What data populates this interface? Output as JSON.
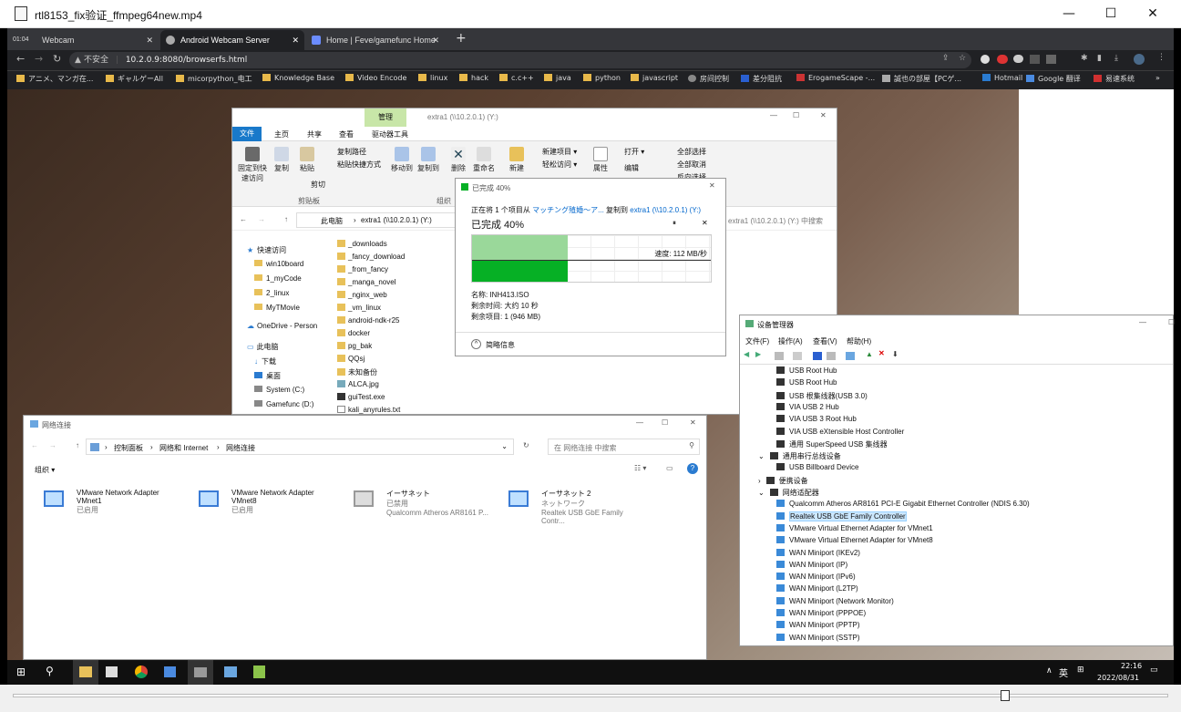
{
  "player": {
    "title": "rtl8153_fix验证_ffmpeg64new.mp4",
    "min": "—",
    "max": "☐",
    "close": "✕"
  },
  "browser": {
    "tabs": [
      {
        "label": "Webcam",
        "prefix": "01:04"
      },
      {
        "label": "Android Webcam Server"
      },
      {
        "label": "Home | Feve/gamefunc Home"
      }
    ],
    "new_tab": "+",
    "url_warning": "不安全",
    "url": "10.2.0.9:8080/browserfs.html",
    "bookmarks": [
      "アニメ、マンガ在...",
      "ギャルゲーAll",
      "micorpython_电工",
      "Knowledge Base",
      "Video Encode",
      "linux",
      "hack",
      "c.c++",
      "java",
      "python",
      "javascript",
      "房间控制",
      "差分阻抗",
      "ErogameScape -...",
      "誠也の部屋【PCゲ...",
      "Hotmail",
      "Google 翻译",
      "易速系统"
    ]
  },
  "explorer": {
    "title": "extra1 (\\\\10.2.0.1) (Y:)",
    "manage_tab": "管理",
    "tabs": [
      "文件",
      "主页",
      "共享",
      "查看",
      "驱动器工具"
    ],
    "ribbon": {
      "pin": "固定到快\n速访问",
      "copy": "复制",
      "paste": "粘贴",
      "copy_path": "复制路径",
      "paste_shortcut": "粘贴快捷方式",
      "cut": "剪切",
      "clipboard": "剪贴板",
      "move_to": "移动到",
      "copy_to": "复制到",
      "delete": "删除",
      "rename": "重命名",
      "organize": "组织",
      "new_folder": "新建",
      "new_item": "新建项目 ▾",
      "easy_access": "轻松访问 ▾",
      "properties": "属性",
      "open": "打开 ▾",
      "edit": "编辑",
      "select_all": "全部选择",
      "select_none": "全部取消",
      "invert": "反向选择"
    },
    "breadcrumb": [
      "此电脑",
      "extra1 (\\\\10.2.0.1) (Y:)"
    ],
    "search_placeholder": "extra1 (\\\\10.2.0.1) (Y:) 中搜索",
    "tree": [
      "快速访问",
      "win10board",
      "1_myCode",
      "2_linux",
      "MyTMovie",
      "OneDrive - Person",
      "此电脑",
      "下载",
      "桌面",
      "System (C:)",
      "Gamefunc (D:)"
    ],
    "files": [
      "_downloads",
      "_fancy_download",
      "_from_fancy",
      "_manga_novel",
      "_nginx_web",
      "_vm_linux",
      "android-ndk-r25",
      "docker",
      "pg_bak",
      "QQsj",
      "未知备份",
      "ALCA.jpg",
      "guiTest.exe",
      "kali_anyrules.txt"
    ]
  },
  "copy_dialog": {
    "title": "已完成 40%",
    "line_prefix": "正在将 1 个项目从",
    "source": "マッチング殖婚～ア...",
    "line_mid": "复制到",
    "dest": "extra1 (\\\\10.2.0.1) (Y:)",
    "heading": "已完成 40%",
    "progress": 0.4,
    "speed": "速度: 112 MB/秒",
    "name": "名称: INH413.ISO",
    "time": "剩余时间: 大约 10 秒",
    "items": "剩余项目: 1 (946 MB)",
    "less": "简略信息",
    "pause": "⏸",
    "close": "✕"
  },
  "devmgr": {
    "title": "设备管理器",
    "menu": [
      "文件(F)",
      "操作(A)",
      "查看(V)",
      "帮助(H)"
    ],
    "devices": [
      {
        "label": "USB Root Hub",
        "indent": 2
      },
      {
        "label": "USB Root Hub",
        "indent": 2
      },
      {
        "label": "USB 根集线器(USB 3.0)",
        "indent": 2
      },
      {
        "label": "VIA USB 2 Hub",
        "indent": 2
      },
      {
        "label": "VIA USB 3 Root Hub",
        "indent": 2
      },
      {
        "label": "VIA USB eXtensible Host Controller",
        "indent": 2
      },
      {
        "label": "通用 SuperSpeed USB 集线器",
        "indent": 2
      },
      {
        "label": "通用串行总线设备",
        "indent": 1,
        "expander": "⌄"
      },
      {
        "label": "USB Billboard Device",
        "indent": 2
      },
      {
        "label": "便携设备",
        "indent": 1,
        "expander": "›"
      },
      {
        "label": "网络适配器",
        "indent": 1,
        "expander": "⌄"
      },
      {
        "label": "Qualcomm Atheros AR8161 PCI-E Gigabit Ethernet Controller (NDIS 6.30)",
        "indent": 2
      },
      {
        "label": "Realtek USB GbE Family Controller",
        "indent": 2,
        "selected": true
      },
      {
        "label": "VMware Virtual Ethernet Adapter for VMnet1",
        "indent": 2
      },
      {
        "label": "VMware Virtual Ethernet Adapter for VMnet8",
        "indent": 2
      },
      {
        "label": "WAN Miniport (IKEv2)",
        "indent": 2
      },
      {
        "label": "WAN Miniport (IP)",
        "indent": 2
      },
      {
        "label": "WAN Miniport (IPv6)",
        "indent": 2
      },
      {
        "label": "WAN Miniport (L2TP)",
        "indent": 2
      },
      {
        "label": "WAN Miniport (Network Monitor)",
        "indent": 2
      },
      {
        "label": "WAN Miniport (PPPOE)",
        "indent": 2
      },
      {
        "label": "WAN Miniport (PPTP)",
        "indent": 2
      },
      {
        "label": "WAN Miniport (SSTP)",
        "indent": 2
      }
    ]
  },
  "netconn": {
    "title": "网络连接",
    "breadcrumb": [
      "控制面板",
      "网络和 Internet",
      "网络连接"
    ],
    "search_placeholder": "在 网络连接 中搜索",
    "organize": "组织 ▾",
    "adapters": [
      {
        "name": "VMware Network Adapter VMnet1",
        "status": "已启用",
        "device": ""
      },
      {
        "name": "VMware Network Adapter VMnet8",
        "status": "已启用",
        "device": ""
      },
      {
        "name": "イーサネット",
        "status": "已禁用",
        "device": "Qualcomm Atheros AR8161 P..."
      },
      {
        "name": "イーサネット 2",
        "status": "ネットワーク",
        "device": "Realtek USB GbE Family Contr..."
      }
    ]
  },
  "taskbar": {
    "ime": "英",
    "time": "22:16",
    "date": "2022/08/31",
    "tray_up": "∧"
  },
  "colors": {
    "accent": "#0078d7",
    "progress": "#06b025",
    "manage_tab": "#c8e6a8"
  }
}
